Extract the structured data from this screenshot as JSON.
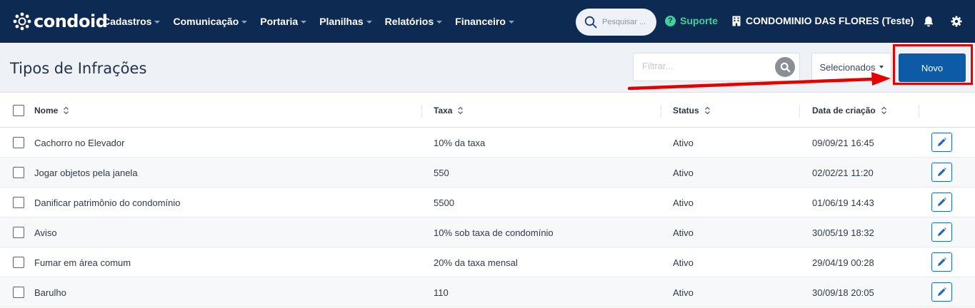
{
  "brand": {
    "name": "condoid"
  },
  "nav": {
    "items": [
      {
        "label": "Cadastros"
      },
      {
        "label": "Comunicação"
      },
      {
        "label": "Portaria"
      },
      {
        "label": "Planilhas"
      },
      {
        "label": "Relatórios"
      },
      {
        "label": "Financeiro"
      }
    ],
    "search_placeholder": "Pesquisar ...",
    "support_label": "Suporte",
    "condo_name": "CONDOMINIO DAS FLORES (Teste)"
  },
  "toolbar": {
    "title": "Tipos de Infrações",
    "filter_placeholder": "Filtrar...",
    "selected_label": "Selecionados",
    "new_label": "Novo"
  },
  "table": {
    "columns": [
      {
        "label": "Nome"
      },
      {
        "label": "Taxa"
      },
      {
        "label": "Status"
      },
      {
        "label": "Data de criação"
      }
    ],
    "rows": [
      {
        "nome": "Cachorro no Elevador",
        "taxa": "10% da taxa",
        "status": "Ativo",
        "data": "09/09/21 16:45"
      },
      {
        "nome": "Jogar objetos pela janela",
        "taxa": "550",
        "status": "Ativo",
        "data": "02/02/21 11:20"
      },
      {
        "nome": "Danificar patrimônio do condomínio",
        "taxa": "5500",
        "status": "Ativo",
        "data": "01/06/19 14:43"
      },
      {
        "nome": "Aviso",
        "taxa": "10% sob taxa de condomínio",
        "status": "Ativo",
        "data": "30/05/19 18:32"
      },
      {
        "nome": "Fumar em área comum",
        "taxa": "20% da taxa mensal",
        "status": "Ativo",
        "data": "29/04/19 00:28"
      },
      {
        "nome": "Barulho",
        "taxa": "110",
        "status": "Ativo",
        "data": "30/09/18 20:05"
      }
    ]
  },
  "colors": {
    "navbar": "#0c2a52",
    "accent": "#0d5aa7",
    "support": "#3fd39b",
    "highlight": "#e60000"
  }
}
